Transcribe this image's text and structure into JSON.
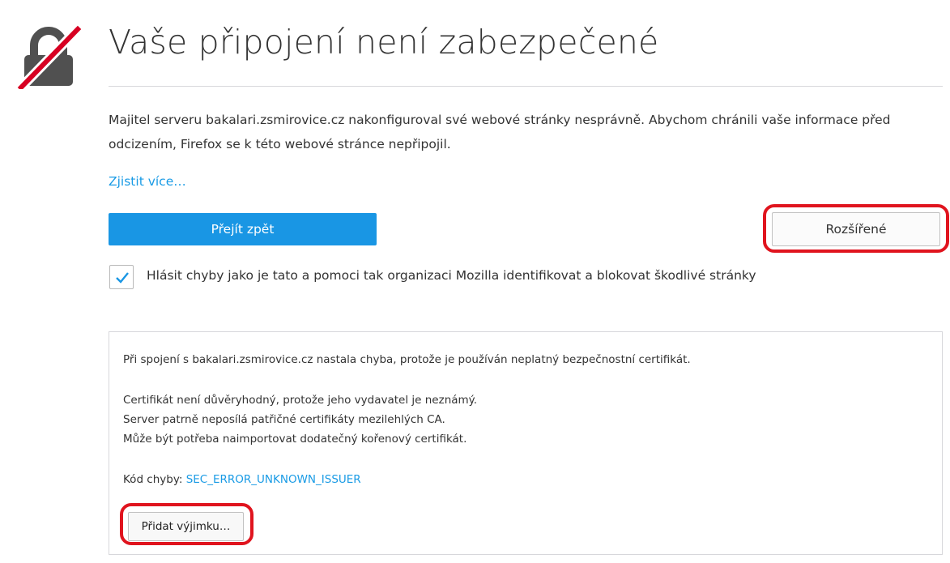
{
  "header": {
    "title": "Vaše připojení není zabezpečené"
  },
  "icons": {
    "warning": "broken-lock-icon",
    "checkmark": "checkmark-icon"
  },
  "colors": {
    "accent": "#1996e4",
    "link": "#1a9be5",
    "highlight": "#e0141e",
    "lock_gray": "#505050",
    "slash_red": "#d70022"
  },
  "main": {
    "description": "Majitel serveru bakalari.zsmirovice.cz nakonfiguroval své webové stránky nesprávně. Abychom chránili vaše informace před odcizením, Firefox se k této webové stránce nepřipojil.",
    "learn_more": "Zjistit více…",
    "go_back_label": "Přejít zpět",
    "advanced_label": "Rozšířené",
    "report_checkbox": {
      "checked": true,
      "label": "Hlásit chyby jako je tato a pomoci tak organizaci Mozilla identifikovat a blokovat škodlivé stránky"
    }
  },
  "details": {
    "intro": "Při spojení s bakalari.zsmirovice.cz nastala chyba, protože je používán neplatný bezpečnostní certifikát.",
    "reasons": [
      "Certifikát není důvěryhodný, protože jeho vydavatel je neznámý.",
      "Server patrně neposílá patřičné certifikáty mezilehlých CA.",
      "Může být potřeba naimportovat dodatečný kořenový certifikát."
    ],
    "error_code_label": "Kód chyby:",
    "error_code": "SEC_ERROR_UNKNOWN_ISSUER",
    "add_exception_label": "Přidat výjimku…"
  }
}
